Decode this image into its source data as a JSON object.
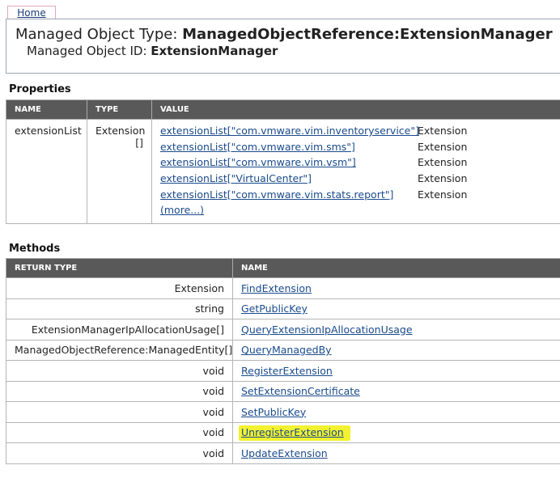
{
  "nav": {
    "home_label": "Home"
  },
  "header": {
    "type_prefix": "Managed Object Type: ",
    "type_value": "ManagedObjectReference:ExtensionManager",
    "id_prefix": "Managed Object ID: ",
    "id_value": "ExtensionManager"
  },
  "properties": {
    "title": "Properties",
    "columns": [
      "NAME",
      "TYPE",
      "VALUE"
    ],
    "rows": [
      {
        "name": "extensionList",
        "type_line1": "Extension",
        "type_line2": "[]",
        "values": [
          {
            "link": "extensionList[\"com.vmware.vim.inventoryservice\"]",
            "type": "Extension"
          },
          {
            "link": "extensionList[\"com.vmware.vim.sms\"]",
            "type": "Extension"
          },
          {
            "link": "extensionList[\"com.vmware.vim.vsm\"]",
            "type": "Extension"
          },
          {
            "link": "extensionList[\"VirtualCenter\"]",
            "type": "Extension"
          },
          {
            "link": "extensionList[\"com.vmware.vim.stats.report\"]",
            "type": "Extension"
          }
        ],
        "more_label": "(more...)"
      }
    ]
  },
  "methods": {
    "title": "Methods",
    "columns": [
      "RETURN TYPE",
      "NAME"
    ],
    "rows": [
      {
        "return_type": "Extension",
        "name": "FindExtension"
      },
      {
        "return_type": "string",
        "name": "GetPublicKey"
      },
      {
        "return_type": "ExtensionManagerIpAllocationUsage[]",
        "name": "QueryExtensionIpAllocationUsage"
      },
      {
        "return_type": "ManagedObjectReference:ManagedEntity[]",
        "name": "QueryManagedBy"
      },
      {
        "return_type": "void",
        "name": "RegisterExtension"
      },
      {
        "return_type": "void",
        "name": "SetExtensionCertificate"
      },
      {
        "return_type": "void",
        "name": "SetPublicKey"
      },
      {
        "return_type": "void",
        "name": "UnregisterExtension",
        "highlighted": true
      },
      {
        "return_type": "void",
        "name": "UpdateExtension"
      }
    ]
  },
  "colors": {
    "header_bg": "#595959",
    "link": "#1a4b8c",
    "highlight": "#f2f230"
  }
}
